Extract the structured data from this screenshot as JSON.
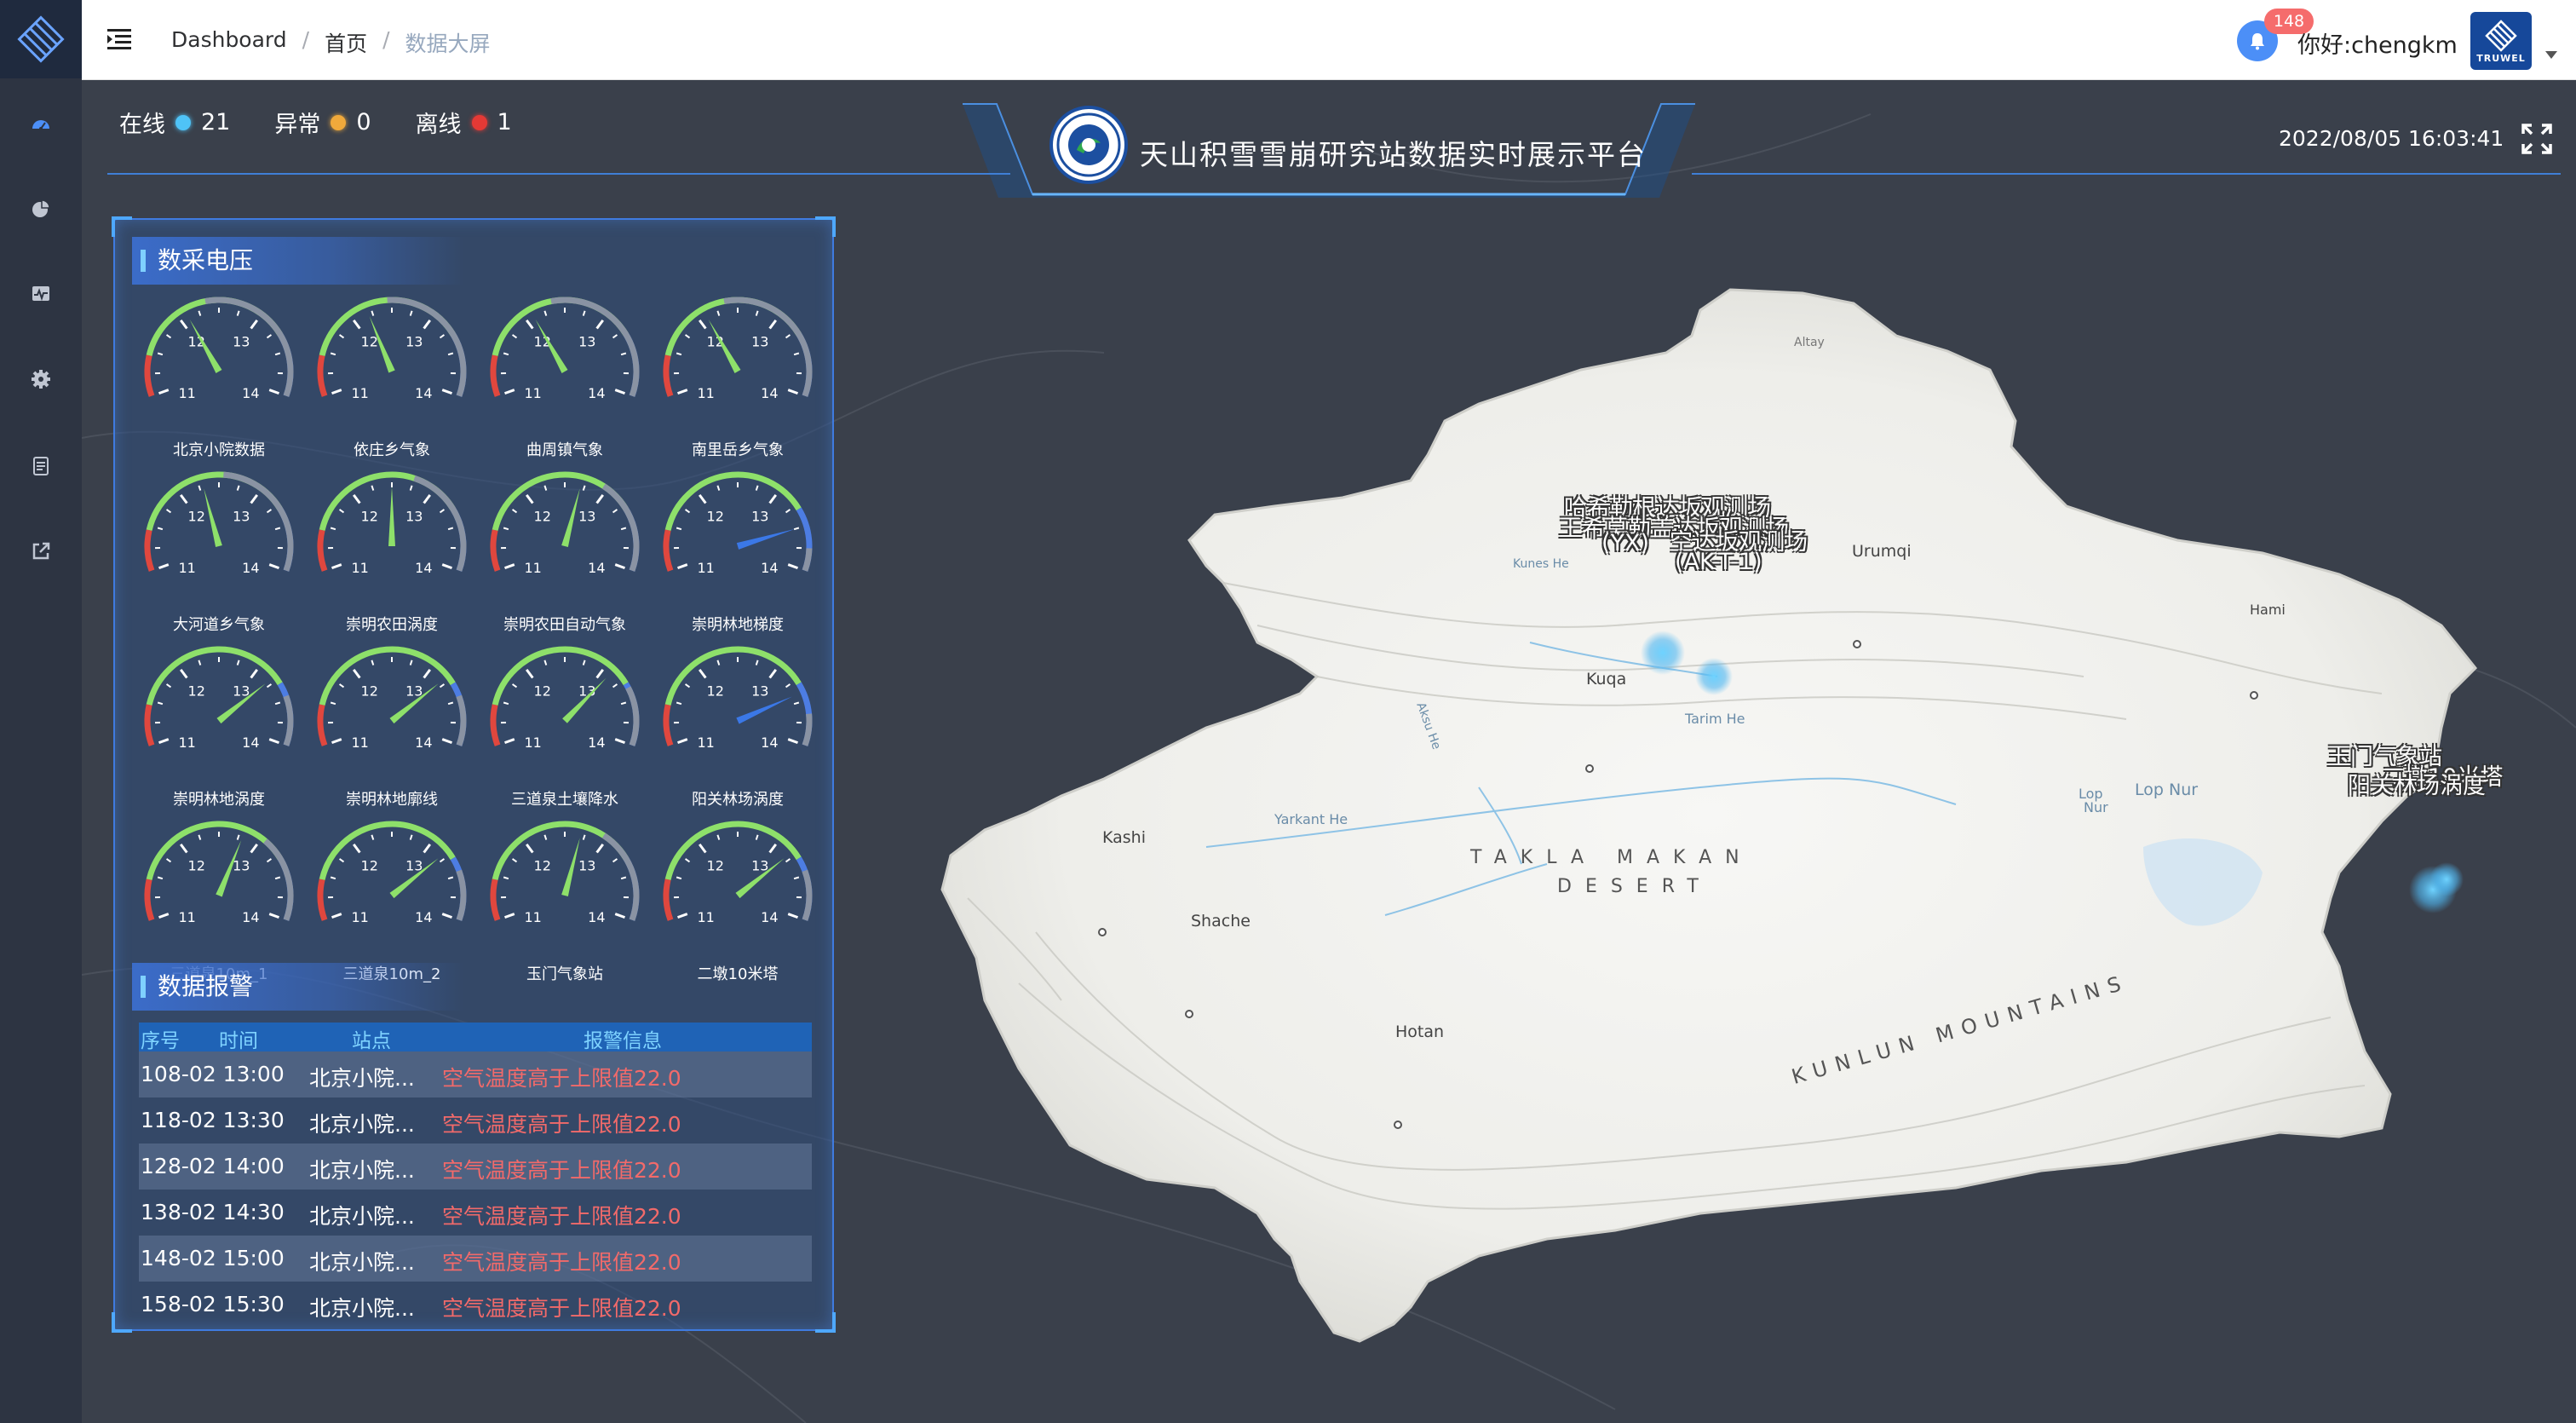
{
  "breadcrumb": {
    "items": [
      "Dashboard",
      "首页"
    ],
    "current": "数据大屏"
  },
  "user": {
    "greeting": "你好:chengkm",
    "notification_count": "148",
    "brand": "TRUWEL"
  },
  "header": {
    "title": "天山积雪雪崩研究站数据实时展示平台",
    "datetime": "2022/08/05 16:03:41"
  },
  "status": [
    {
      "label": "在线",
      "count": "21",
      "color": "#4fc3f7"
    },
    {
      "label": "异常",
      "count": "0",
      "color": "#f0a93b"
    },
    {
      "label": "离线",
      "count": "1",
      "color": "#e53935"
    }
  ],
  "voltage_section": {
    "title": "数采电压",
    "gauges": [
      {
        "name": "北京小院数据",
        "value": 12.1
      },
      {
        "name": "依庄乡气象",
        "value": 12.2
      },
      {
        "name": "曲周镇气象",
        "value": 12.1
      },
      {
        "name": "南里岳乡气象",
        "value": 12.1
      },
      {
        "name": "大河道乡气象",
        "value": 12.3
      },
      {
        "name": "崇明农田涡度",
        "value": 12.5
      },
      {
        "name": "崇明农田自动气象",
        "value": 12.7
      },
      {
        "name": "崇明林地梯度",
        "value": 13.5
      },
      {
        "name": "崇明林地涡度",
        "value": 13.2
      },
      {
        "name": "崇明林地廓线",
        "value": 13.2
      },
      {
        "name": "三道泉土壤降水",
        "value": 13.1
      },
      {
        "name": "阳关林场涡度",
        "value": 13.4
      },
      {
        "name": "三道泉10m_1",
        "value": 12.8
      },
      {
        "name": "三道泉10m_2",
        "value": 13.2
      },
      {
        "name": "玉门气象站",
        "value": 12.7
      },
      {
        "name": "二墩10米塔",
        "value": 13.2
      }
    ],
    "tick_labels": [
      "11",
      "12",
      "13",
      "14"
    ]
  },
  "alarm_section": {
    "title": "数据报警",
    "columns": [
      "序号",
      "时间",
      "站点",
      "报警信息"
    ],
    "rows": [
      {
        "id": "10",
        "time": "8-02 13:00",
        "site": "北京小院...",
        "msg": "空气温度高于上限值22.0"
      },
      {
        "id": "11",
        "time": "8-02 13:30",
        "site": "北京小院...",
        "msg": "空气温度高于上限值22.0"
      },
      {
        "id": "12",
        "time": "8-02 14:00",
        "site": "北京小院...",
        "msg": "空气温度高于上限值22.0"
      },
      {
        "id": "13",
        "time": "8-02 14:30",
        "site": "北京小院...",
        "msg": "空气温度高于上限值22.0"
      },
      {
        "id": "14",
        "time": "8-02 15:00",
        "site": "北京小院...",
        "msg": "空气温度高于上限值22.0"
      },
      {
        "id": "15",
        "time": "8-02 15:30",
        "site": "北京小院...",
        "msg": "空气温度高于上限值22.0"
      }
    ]
  },
  "map": {
    "station_labels_west": [
      "哈希勒根达坂观测场",
      "王希莫勒盖达坂观测场",
      "(YX)",
      "空达坂观测场",
      "(AK-T-1)"
    ],
    "station_labels_east": [
      "玉门气象站",
      "二墩10米塔",
      "阳关林场涡度"
    ],
    "place_names": [
      "Urumqi",
      "Kuqa",
      "Kashi",
      "Shache",
      "Hotan",
      "Lop Nur",
      "Lop",
      "Nur",
      "Hami",
      "Tarim He",
      "Yarkant He",
      "Altay",
      "Kunes He",
      "Aksu He"
    ],
    "desert": [
      "TAKLA MAKAN",
      "DESERT"
    ],
    "mountains": "KUNLUN MOUNTAINS"
  },
  "icons": [
    "dashboard-icon",
    "pie-chart-icon",
    "monitor-icon",
    "gear-icon",
    "document-icon",
    "external-link-icon",
    "bell-icon",
    "fullscreen-icon",
    "menu-toggle-icon"
  ]
}
